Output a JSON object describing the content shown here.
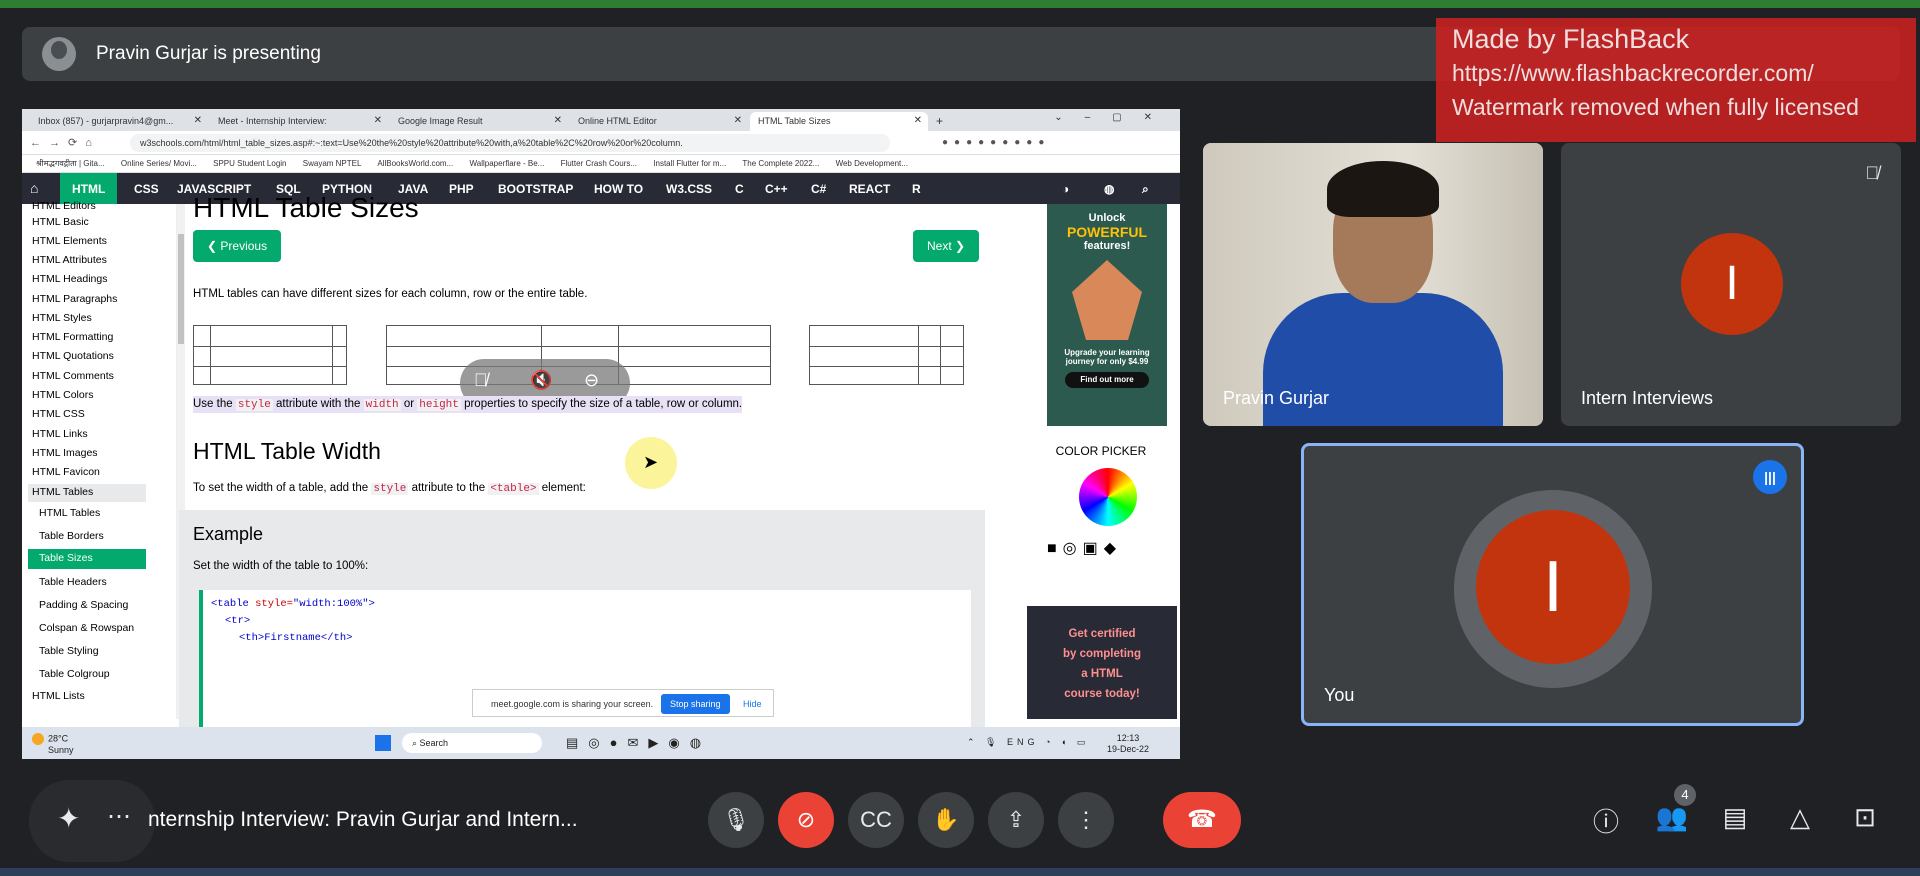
{
  "banner": {
    "presenter_text": "Pravin Gurjar is presenting"
  },
  "watermark": {
    "line1": "Made by FlashBack",
    "line2": "https://www.flashbackrecorder.com/",
    "line3": "Watermark removed when fully licensed"
  },
  "browser": {
    "tabs": [
      "Inbox (857) - gurjarpravin4@gm...",
      "Meet - Internship Interview:",
      "Google Image Result",
      "Online HTML Editor",
      "HTML Table Sizes"
    ],
    "new_tab": "+",
    "url": "w3schools.com/html/html_table_sizes.asp#:~:text=Use%20the%20style%20attribute%20with,a%20table%2C%20row%20or%20column.",
    "bookmarks": [
      "श्रीमद्भगवद्गीता | Gita...",
      "Online Series/ Movi...",
      "SPPU Student Login",
      "Swayam NPTEL",
      "AllBooksWorld.com...",
      "Wallpaperflare - Be...",
      "Flutter Crash Cours...",
      "Install Flutter for m...",
      "The Complete 2022...",
      "Web Development..."
    ]
  },
  "w3": {
    "nav": [
      "HTML",
      "CSS",
      "JAVASCRIPT",
      "SQL",
      "PYTHON",
      "JAVA",
      "PHP",
      "BOOTSTRAP",
      "HOW TO",
      "W3.CSS",
      "C",
      "C++",
      "C#",
      "REACT",
      "R"
    ],
    "sidebar": [
      "HTML Editors",
      "HTML Basic",
      "HTML Elements",
      "HTML Attributes",
      "HTML Headings",
      "HTML Paragraphs",
      "HTML Styles",
      "HTML Formatting",
      "HTML Quotations",
      "HTML Comments",
      "HTML Colors",
      "HTML CSS",
      "HTML Links",
      "HTML Images",
      "HTML Favicon",
      "HTML Tables",
      "HTML Tables",
      "Table Borders",
      "Table Sizes",
      "Table Headers",
      "Padding & Spacing",
      "Colspan & Rowspan",
      "Table Styling",
      "Table Colgroup",
      "HTML Lists"
    ],
    "page_title": "HTML Table Sizes",
    "prev": "❮ Previous",
    "next": "Next ❯",
    "intro": "HTML tables can have different sizes for each column, row or the entire table.",
    "use_pre": "Use the ",
    "use_style": "style",
    "use_mid": " attribute with the ",
    "use_width": "width",
    "use_or": " or ",
    "use_height": "height",
    "use_post": " properties to specify the size of a table, row or column.",
    "h2": "HTML Table Width",
    "width_pre": "To set the width of a table, add the ",
    "width_style": "style",
    "width_mid": " attribute to the ",
    "width_table": "<table>",
    "width_post": " element:",
    "example_title": "Example",
    "example_desc": "Set the width of the table to 100%:",
    "code1_tag": "<table ",
    "code1_attr": "style=",
    "code1_val": "\"width:100%\">",
    "code2": "<tr>",
    "code3": "<th>Firstname</th>",
    "share_msg": "meet.google.com is sharing your screen.",
    "share_stop": "Stop sharing",
    "share_hide": "Hide",
    "ad": {
      "unlock": "Unlock",
      "powerful": "POWERFUL",
      "features": "features!",
      "upgrade": "Upgrade your learning journey for only $4.99",
      "find": "Find out more",
      "color_picker": "COLOR PICKER",
      "cert1": "Get certified",
      "cert2": "by completing",
      "cert3": "a HTML",
      "cert4": "course today!"
    }
  },
  "taskbar": {
    "temp": "28°C",
    "cond": "Sunny",
    "search": "Search",
    "lang": "ENG",
    "time": "12:13",
    "date": "19-Dec-22"
  },
  "tiles": {
    "pravin": {
      "name": "Pravin Gurjar"
    },
    "intern": {
      "name": "Intern Interviews",
      "initial": "I"
    },
    "you": {
      "name": "You",
      "initial": "I"
    }
  },
  "bottom": {
    "meeting_title": "nternship Interview: Pravin Gurjar and Intern...",
    "participants_count": "4"
  },
  "colors": {
    "w3_green": "#04aa6d",
    "avatar_red": "#c1340e",
    "end_call_red": "#ea4335",
    "tile_bg": "#3c4043",
    "active_border": "#8ab4f8"
  }
}
